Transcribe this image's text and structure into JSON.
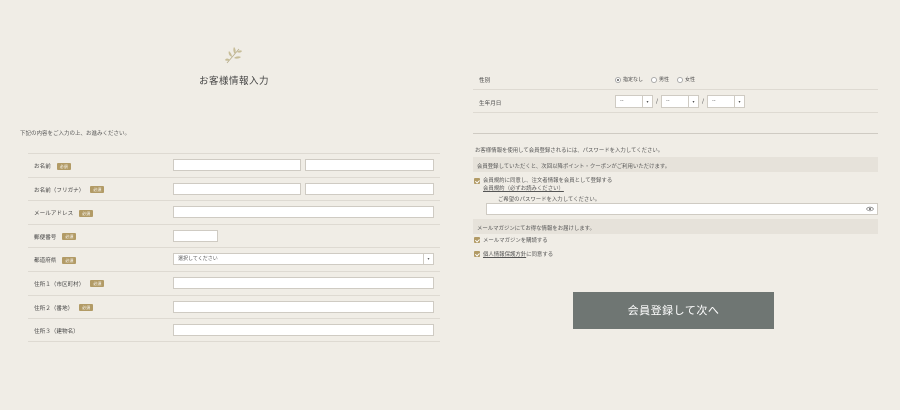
{
  "page": {
    "title": "お客様情報入力",
    "intro": "下記の内容をご入力の上、お進みください。",
    "required_badge": "必須"
  },
  "left_form": {
    "rows": [
      {
        "label": "お名前",
        "required": true,
        "kind": "two-inputs"
      },
      {
        "label": "お名前（フリガナ）",
        "required": true,
        "kind": "two-inputs"
      },
      {
        "label": "メールアドレス",
        "required": true,
        "kind": "input"
      },
      {
        "label": "郵便番号",
        "required": true,
        "kind": "short-input"
      },
      {
        "label": "都道府県",
        "required": true,
        "kind": "select",
        "value": "選択してください"
      },
      {
        "label": "住所１（市区町村）",
        "required": true,
        "kind": "input"
      },
      {
        "label": "住所２（番地）",
        "required": true,
        "kind": "input"
      },
      {
        "label": "住所３（建物名）",
        "required": false,
        "kind": "input"
      }
    ]
  },
  "right_form": {
    "gender": {
      "label": "性別",
      "options": [
        "指定なし",
        "男性",
        "女性"
      ],
      "selected": "指定なし"
    },
    "birthday": {
      "label": "生年月日",
      "placeholder": "--",
      "separator": "/"
    },
    "member": {
      "notice": "お客様情報を使用して会員登録されるには、パスワードを入力してください。",
      "band1": "会員登録していただくと、次回以降ポイント・クーポンがご利用いただけます。",
      "agree_text": "会員規約に同意し、注文者情報を会員として登録する",
      "agree_link": "会員規約（必ずお読みください）",
      "agree_checked": true,
      "password_prompt": "ご希望のパスワードを入力してください。",
      "band2": "メールマガジンにてお得な情報をお届けします。",
      "mailmag_label": "メールマガジンを購読する",
      "mailmag_checked": true,
      "privacy_link": "個人情報保護方針",
      "privacy_suffix": "に同意する",
      "privacy_checked": true
    },
    "submit_label": "会員登録して次へ"
  },
  "colors": {
    "background": "#f0ede6",
    "accent": "#b29b66",
    "button": "#6f7673"
  },
  "icons": [
    "leaf-icon",
    "select-arrow-icon",
    "eye-icon",
    "checkbox-checked-icon"
  ]
}
